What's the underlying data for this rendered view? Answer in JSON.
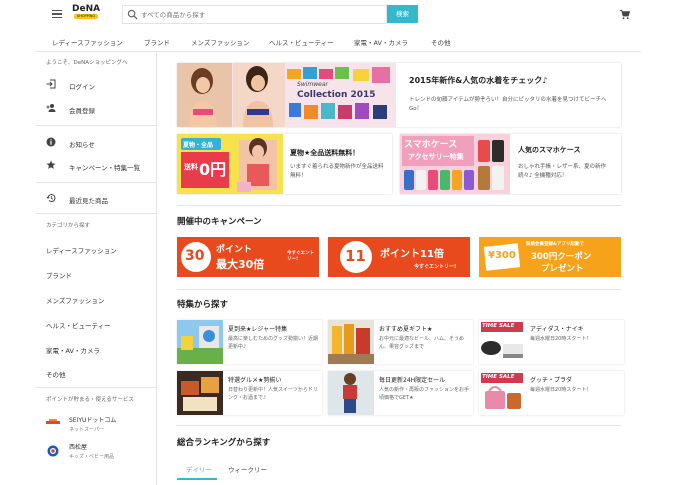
{
  "header": {
    "logo_text": "DeNA",
    "logo_sub": "SHOPPING",
    "search_placeholder": "すべての商品から探す",
    "search_button": "検索"
  },
  "categories": [
    "レディースファッション",
    "ブランド",
    "メンズファッション",
    "ヘルス・ビューティー",
    "家電・AV・カメラ",
    "その他"
  ],
  "sidebar": {
    "welcome": "ようこそ、DeNAショッピングへ",
    "login": "ログイン",
    "register": "会員登録",
    "news": "お知らせ",
    "campaigns": "キャンペーン・特集一覧",
    "recent": "最近見た商品",
    "category_heading": "カテゴリから探す",
    "categories": [
      "レディースファッション",
      "ブランド",
      "メンズファッション",
      "ヘルス・ビューティー",
      "家電・AV・カメラ",
      "その他"
    ],
    "points_heading": "ポイントが貯まる・使えるサービス",
    "services": [
      {
        "name": "SEIYUドットコム",
        "sub": "ネットスーパー"
      },
      {
        "name": "西松屋",
        "sub": "キッズ・ベビー用品"
      }
    ]
  },
  "promos": {
    "swimwear": {
      "title": "2015年新作&人気の水着をチェック♪",
      "desc": "トレンドの旬顔アイテムが勢ぞろい！自分にピッタリの水着を見つけてビーチへGo！",
      "image_text_1": "Swimwear",
      "image_text_2": "Collection 2015"
    },
    "shipping": {
      "title": "夏物★全品送料無料！",
      "desc": "いますぐ着られる夏物新作が全品送料無料！",
      "image_text_1": "夏物・全品",
      "image_text_2": "送料",
      "image_text_3": "0円"
    },
    "phonecase": {
      "title": "人気のスマホケース",
      "desc": "おしゃれ手帳・レザー系、夏の新作続々♪ 全機種対応！",
      "image_text_1": "スマホケース",
      "image_text_2": "アクセサリー特集"
    }
  },
  "campaign_section": {
    "heading": "開催中のキャンペーン",
    "c1_num": "30",
    "c1_line1": "ポイント",
    "c1_line2": "最大30倍",
    "c1_tag": "今すぐエントリー!",
    "c2_num": "11",
    "c2_line1": "ポイント11倍",
    "c2_tag": "今すぐエントリー!",
    "c3_num": "¥300",
    "c3_small": "新規会員登録&アプリ起動で",
    "c3_line1": "300円クーポン",
    "c3_line2": "プレゼント"
  },
  "feature_section": {
    "heading": "特集から探す",
    "items": [
      {
        "title": "夏到来★レジャー特集",
        "desc": "最高に楽しむためのグッズ勢揃い！近期更新中♪"
      },
      {
        "title": "おすすめ夏ギフト★",
        "desc": "お中元に最適なビール、ハム、そうめん、果容グッズまで"
      },
      {
        "title": "アディダス・ナイキ",
        "desc": "毎週水曜日20時スタート！",
        "badge": "TIME SALE"
      },
      {
        "title": "特選グルメ★勢揃い",
        "desc": "日替わり更新中！人気スイーツからドリンク・お酒まで♪"
      },
      {
        "title": "毎日更新24H限定セール",
        "desc": "人気の新作・再販のファッションをお手頃価格でGET★"
      },
      {
        "title": "グッチ・プラダ",
        "desc": "毎週水曜日20時スタート！",
        "badge": "TIME SALE"
      }
    ]
  },
  "ranking": {
    "heading": "総合ランキングから探す",
    "tabs": [
      "デイリー",
      "ウィークリー"
    ]
  },
  "colors": {
    "accent": "#35b8cb",
    "campaign_red": "#e84a1d",
    "campaign_orange": "#f6a21a",
    "timesale": "#cf3a4f"
  }
}
